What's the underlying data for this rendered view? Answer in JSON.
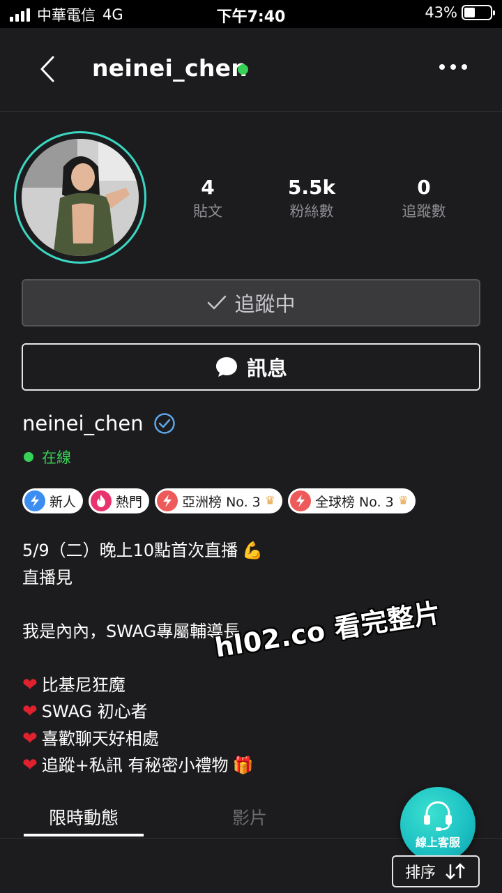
{
  "status_bar": {
    "carrier": "中華電信",
    "network": "4G",
    "time": "下午7:40",
    "battery": "43%",
    "battery_level": 0.43
  },
  "header": {
    "title": "neinei_chen",
    "back_icon": "chevron-left-icon",
    "more_icon": "more-horizontal-icon"
  },
  "profile": {
    "stats": [
      {
        "value": "4",
        "label": "貼文"
      },
      {
        "value": "5.5k",
        "label": "粉絲數"
      },
      {
        "value": "0",
        "label": "追蹤數"
      }
    ],
    "follow_button": "追蹤中",
    "message_button": "訊息",
    "name": "neinei_chen",
    "online_status": "在線"
  },
  "badges": [
    {
      "label": "新人",
      "icon": "lightning-icon",
      "color": "#3b8df0"
    },
    {
      "label": "熱門",
      "icon": "flame-icon",
      "color": "#e8336e"
    },
    {
      "label": "亞洲榜 No. 3",
      "icon": "lightning-icon",
      "color": "#ee5a5a",
      "crown": true
    },
    {
      "label": "全球榜 No. 3",
      "icon": "lightning-icon",
      "color": "#ee5a5a",
      "crown": true
    }
  ],
  "bio": {
    "line1": "5/9（二）晚上10點首次直播",
    "line1_emoji": "💪",
    "line2": "直播見",
    "line3": "我是內內，SWAG專屬輔導長",
    "items": [
      "比基尼狂魔",
      "SWAG 初心者",
      "喜歡聊天好相處",
      "追蹤+私訊 有秘密小禮物"
    ],
    "gift_emoji": "🎁"
  },
  "watermark": "hl02.co 看完整片",
  "tabs": [
    {
      "label": "限時動態",
      "active": true
    },
    {
      "label": "影片",
      "active": false
    }
  ],
  "cs_fab": {
    "label": "線上客服",
    "icon": "headset-icon"
  },
  "sort_button": "排序",
  "colors": {
    "background": "#1c1c1e",
    "online": "#37d158",
    "avatar_ring": "#3bd7c2",
    "fab": "#1bbfc2"
  }
}
